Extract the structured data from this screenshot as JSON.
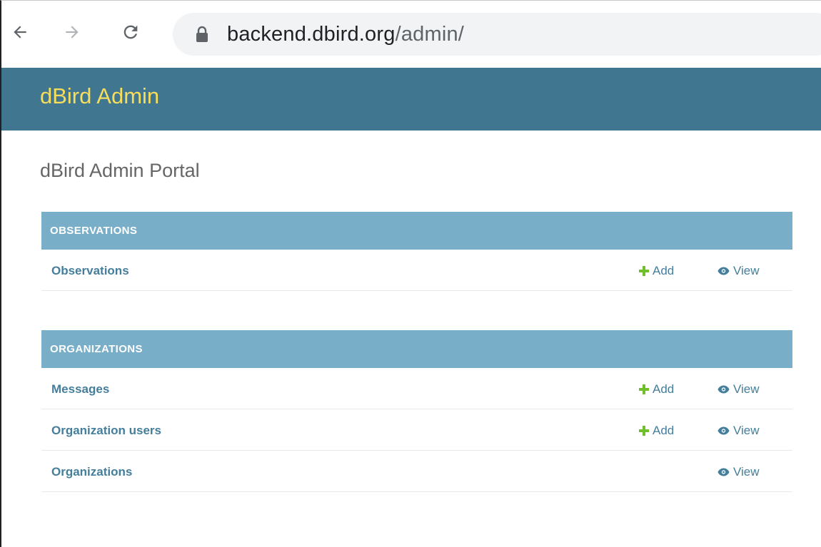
{
  "browser": {
    "url_host": "backend.dbird.org",
    "url_path": "/admin/",
    "icons": {
      "back": "arrow-left-icon",
      "forward": "arrow-right-icon",
      "reload": "reload-icon",
      "lock": "lock-icon"
    }
  },
  "header": {
    "branding": "dBird Admin",
    "background_color": "#417690",
    "branding_color": "#f5dd5d"
  },
  "content": {
    "title": "dBird Admin Portal"
  },
  "modules": [
    {
      "caption": "OBSERVATIONS",
      "models": [
        {
          "name": "Observations",
          "add_label": "Add",
          "view_label": "View"
        }
      ]
    },
    {
      "caption": "ORGANIZATIONS",
      "models": [
        {
          "name": "Messages",
          "add_label": "Add",
          "view_label": "View"
        },
        {
          "name": "Organization users",
          "add_label": "Add",
          "view_label": "View"
        },
        {
          "name": "Organizations",
          "view_label": "View"
        }
      ]
    }
  ],
  "colors": {
    "caption_bg": "#79aec8",
    "link": "#447e9b",
    "add_icon": "#70bf2b"
  }
}
